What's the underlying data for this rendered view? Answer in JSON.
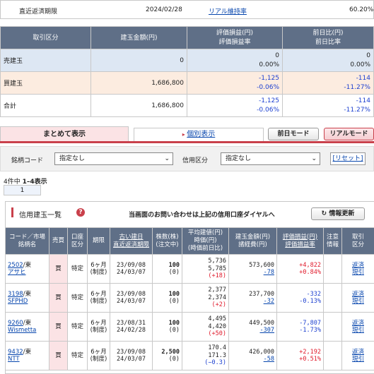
{
  "top": {
    "label": "直近返済期限",
    "date": "2024/02/28",
    "link": "リアル維持率",
    "rate": "60.20%"
  },
  "summary": {
    "headers": [
      "取引区分",
      "建玉金額(円)",
      "評価損益(円)",
      "評価損益率",
      "前日比(円)",
      "前日比率"
    ],
    "rows": [
      {
        "label": "売建玉",
        "amount": "0",
        "pl": "0",
        "pl_rate": "0.00%",
        "dod": "0",
        "dod_rate": "0.00%"
      },
      {
        "label": "買建玉",
        "amount": "1,686,800",
        "pl": "-1,125",
        "pl_rate": "-0.06%",
        "dod": "-114",
        "dod_rate": "-11.27%"
      },
      {
        "label": "合計",
        "amount": "1,686,800",
        "pl": "-1,125",
        "pl_rate": "-0.06%",
        "dod": "-114",
        "dod_rate": "-11.27%"
      }
    ]
  },
  "tabs": {
    "active": "まとめて表示",
    "other": "個別表示",
    "prev_mode": "前日モード",
    "real_mode": "リアルモード"
  },
  "filters": {
    "brand_label": "銘柄コード",
    "brand_value": "指定なし",
    "credit_label": "信用区分",
    "credit_value": "指定なし",
    "reset": "[リセット]"
  },
  "paging": {
    "count": "4件中",
    "range": "1–4表示",
    "page": "1"
  },
  "panel": {
    "title": "信用建玉一覧",
    "notice": "当画面のお問い合わせは上記の信用口座ダイヤルへ",
    "refresh": "情報更新"
  },
  "columns": {
    "code": [
      "コード／市場",
      "銘柄名"
    ],
    "side": "売買",
    "account": [
      "口座",
      "区分"
    ],
    "term": "期限",
    "date": [
      "古い建日",
      "直近返済期限"
    ],
    "shares": [
      "株数(株)",
      "(注文中)"
    ],
    "price": [
      "平均建値(円)",
      "時価(円)",
      "(時価前日比)"
    ],
    "amount": [
      "建玉金額(円)",
      "諸経費(円)"
    ],
    "pl": [
      "評価損益(円)",
      "評価損益率"
    ],
    "note": [
      "注意",
      "情報"
    ],
    "trade": [
      "取引",
      "区分"
    ]
  },
  "positions": [
    {
      "code": "2502",
      "market": "/東",
      "name": "アサヒ",
      "side": "買",
      "account": "特定",
      "term1": "6ヶ月",
      "term2": "(制度)",
      "d1": "23/09/08",
      "d2": "24/03/07",
      "shares": "100",
      "pending": "(0)",
      "avg": "5,736",
      "cur": "5,785",
      "diff": "(+18)",
      "diff_sign": "pos",
      "amount": "573,600",
      "fee": "-78",
      "pl": "+4,822",
      "pl_rate": "+0.84%",
      "pl_sign": "pos",
      "t1": "返済",
      "t2": "現引"
    },
    {
      "code": "3198",
      "market": "/東",
      "name": "SFPHD",
      "side": "買",
      "account": "特定",
      "term1": "6ヶ月",
      "term2": "(制度)",
      "d1": "23/09/08",
      "d2": "24/03/07",
      "shares": "100",
      "pending": "(0)",
      "avg": "2,377",
      "cur": "2,374",
      "diff": "(+2)",
      "diff_sign": "pos",
      "amount": "237,700",
      "fee": "-32",
      "pl": "-332",
      "pl_rate": "-0.13%",
      "pl_sign": "neg",
      "t1": "返済",
      "t2": "現引"
    },
    {
      "code": "9260",
      "market": "/東",
      "name": "Wismetta",
      "side": "買",
      "account": "特定",
      "term1": "6ヶ月",
      "term2": "(制度)",
      "d1": "23/08/31",
      "d2": "24/02/28",
      "shares": "100",
      "pending": "(0)",
      "avg": "4,495",
      "cur": "4,420",
      "diff": "(+50)",
      "diff_sign": "pos",
      "amount": "449,500",
      "fee": "-307",
      "pl": "-7,807",
      "pl_rate": "-1.73%",
      "pl_sign": "neg",
      "t1": "返済",
      "t2": "現引"
    },
    {
      "code": "9432",
      "market": "/東",
      "name": "NTT",
      "side": "買",
      "account": "特定",
      "term1": "6ヶ月",
      "term2": "(制度)",
      "d1": "23/09/08",
      "d2": "24/03/07",
      "shares": "2,500",
      "pending": "(0)",
      "avg": "170.4",
      "cur": "171.3",
      "diff": "(−0.3)",
      "diff_sign": "neg",
      "amount": "426,000",
      "fee": "-58",
      "pl": "+2,192",
      "pl_rate": "+0.51%",
      "pl_sign": "pos",
      "t1": "返済",
      "t2": "現引"
    }
  ]
}
